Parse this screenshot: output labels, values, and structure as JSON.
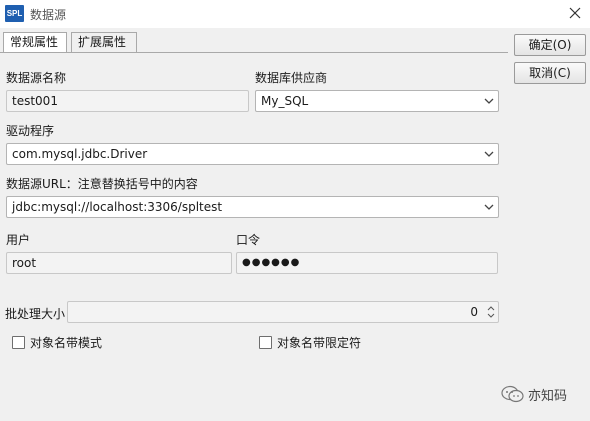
{
  "window": {
    "app_icon_text": "SPL",
    "title": "数据源"
  },
  "tabs": [
    {
      "label": "常规属性",
      "active": true
    },
    {
      "label": "扩展属性",
      "active": false
    }
  ],
  "buttons": {
    "ok": "确定(O)",
    "cancel": "取消(C)"
  },
  "form": {
    "ds_name_label": "数据源名称",
    "ds_name_value": "test001",
    "vendor_label": "数据库供应商",
    "vendor_value": "My_SQL",
    "driver_label": "驱动程序",
    "driver_value": "com.mysql.jdbc.Driver",
    "url_label": "数据源URL：注意替换括号中的内容",
    "url_value": "jdbc:mysql://localhost:3306/spltest",
    "user_label": "用户",
    "user_value": "root",
    "password_label": "口令",
    "password_value": "●●●●●●",
    "batch_label": "批处理大小",
    "batch_value": "0",
    "schema_mode_label": "对象名带模式",
    "schema_mode_checked": false,
    "qualifier_label": "对象名带限定符",
    "qualifier_checked": false
  },
  "watermark": {
    "icon": "wechat-icon",
    "text": "亦知码"
  },
  "colors": {
    "app_icon_bg": "#1f5fb0",
    "dialog_bg": "#f0f0f0"
  }
}
